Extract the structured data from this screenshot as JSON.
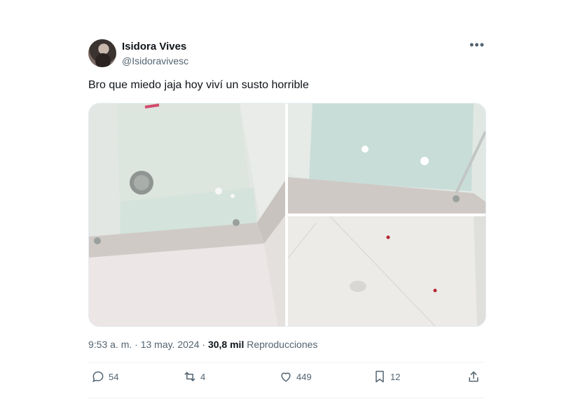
{
  "author": {
    "name": "Isidora Vives",
    "handle": "@Isidoravivesc"
  },
  "more_icon": "more-horizontal-icon",
  "tweet": {
    "text": "Bro que miedo jaja hoy viví un susto horrible"
  },
  "meta": {
    "time": "9:53 a. m.",
    "separator": "·",
    "date": "13 may. 2024",
    "views_count": "30,8 mil",
    "views_label": "Reproducciones"
  },
  "actions": {
    "replies": "54",
    "reposts": "4",
    "likes": "449",
    "bookmarks": "12"
  },
  "colors": {
    "text": "#0f1419",
    "secondary": "#536471",
    "divider": "#eff3f4"
  }
}
